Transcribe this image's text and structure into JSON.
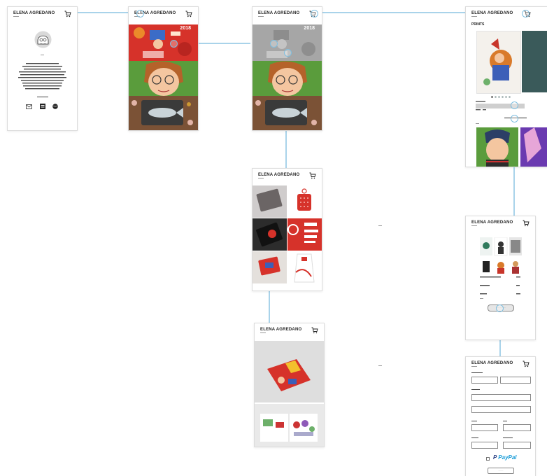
{
  "brand": "ELENA AGREDANO",
  "about": {
    "bio_lines": [
      "··················"
    ],
    "contact_label": "······"
  },
  "hero": {
    "year": "2018"
  },
  "prints": {
    "title": "PRINTS",
    "add_button": "····· ····"
  },
  "cart_screen": {
    "checkout_button": "····· ··· ·····"
  },
  "checkout": {
    "paypal": "PayPal",
    "submit": "·······"
  },
  "colors": {
    "wire": "#a9d3ea",
    "red": "#d6322a",
    "green": "#5a9c3c",
    "paypal_blue": "#253b80",
    "paypal_light": "#179bd7"
  }
}
